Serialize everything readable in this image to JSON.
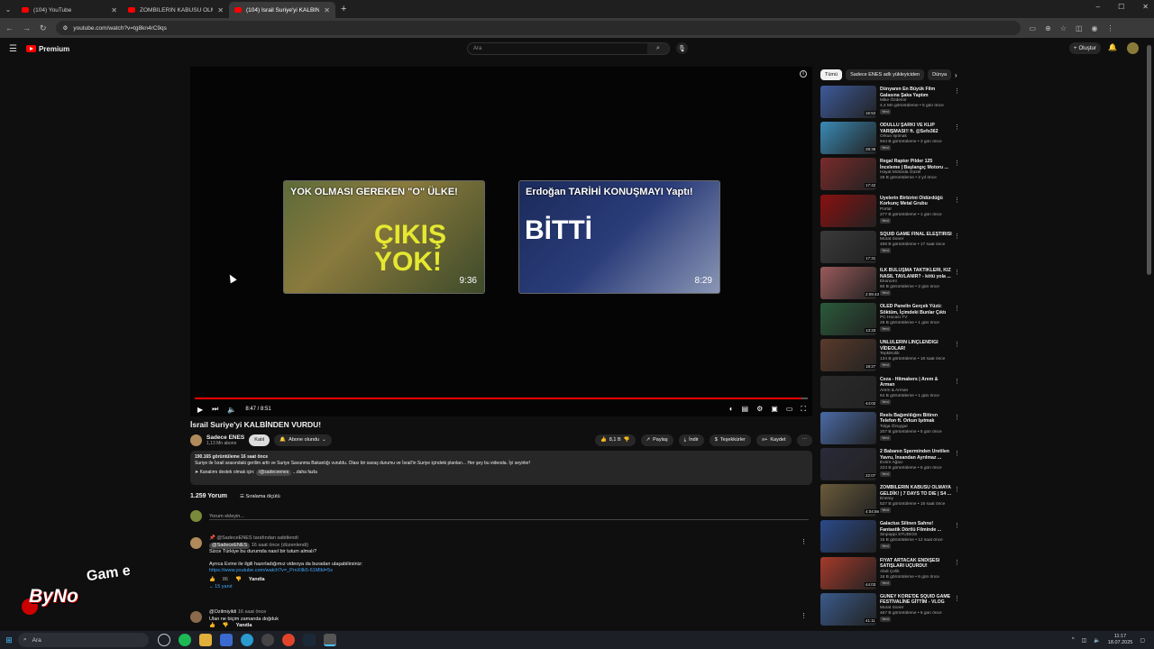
{
  "browser": {
    "tabs": [
      {
        "title": "(104) YouTube",
        "active": false
      },
      {
        "title": "ZOMBİLERİN KABUSU OLMAYA",
        "active": false
      },
      {
        "title": "(104) İsrail Suriye'yi KALBİNDEN",
        "active": true
      }
    ],
    "url": "youtube.com/watch?v=tg8kn4rC9qs"
  },
  "yt": {
    "logo": "Premium",
    "search_placeholder": "Ara",
    "create_label": "Oluştur"
  },
  "player": {
    "endcards": [
      {
        "title": "YOK OLMASI GEREKEN \"O\" ÜLKE!",
        "duration": "9:36"
      },
      {
        "title": "Erdoğan TARİHİ KONUŞMAYI Yaptı!",
        "duration": "8:29"
      }
    ],
    "time": "8:47 / 8:51",
    "progress": 0.99
  },
  "video": {
    "title": "İsrail Suriye'yi KALBİNDEN VURDU!",
    "channel": "Sadece ENES",
    "subs": "1,13 Mn abone",
    "join": "Katıl",
    "subscribed": "Abone olundu",
    "likes": "8,1 B",
    "share": "Paylaş",
    "download": "İndir",
    "thanks": "Teşekkürler",
    "save": "Kaydet",
    "desc_meta": "190.165 görüntüleme  16 saat önce",
    "desc_text": "Suriye ile İsrail arasındaki gerilim arttı ve Suriye Savunma Bakanlığı vuruldu. Olası bir savaş durumu ve İsrail'in Suriye içindeki planları... Her şey bu videoda. İyi seyirler!",
    "desc_support": "➤ Kanalımı destek olmak için:",
    "desc_handle": "/@sadeceenes",
    "desc_more": "...daha fazla"
  },
  "comments": {
    "count": "1.259 Yorum",
    "sort": "Sıralama ölçütü",
    "add_placeholder": "Yorum ekleyin...",
    "items": [
      {
        "pinned": "@SadeceENES tarafından sabitlendi",
        "author": "@SadeceENES",
        "time": "16 saat önce (düzenlendi)",
        "text1": "Sizce Türkiye bu durumda nasıl bir tutum almalı?",
        "text2": "Ayrıca Evine ile ilgili hazırladığımız videoya da buradan ulaşabilirsiniz:",
        "link": "https://www.youtube.com/watch?v=_PrnXIlk5-61Mlbl=5s",
        "likes": "86",
        "reply": "Yanıtla",
        "replies": "15 yanıt"
      },
      {
        "author": "@Ozilmiyildi",
        "time": "16 saat önce",
        "text1": "Ulan ne biçim zamanda doğduk",
        "likes": "",
        "reply": "Yanıtla"
      }
    ]
  },
  "sidebar": {
    "chips": [
      "Tümü",
      "Sadece ENES adlı yükleyiciden",
      "Dünya"
    ],
    "videos": [
      {
        "title": "Dünyanın En Büyük Film Galasına Şaka Yaptım",
        "channel": "Mike Özdemir",
        "meta": "4,4 Mn görüntüleme • 5 gün önce",
        "badge": "Yeni",
        "dur": "16:52",
        "color": "#3d5a9a"
      },
      {
        "title": "ÖDÜLLÜ ŞARKI VE KLİP YARIŞMASI!! ft. @Sefo362",
        "channel": "Orkun Işıtmak",
        "meta": "944 B görüntüleme • 3 gün önce",
        "badge": "Yeni",
        "dur": "28:36",
        "color": "#3a8ab5"
      },
      {
        "title": "Regal Raptor Pilder 125 İnceleme | Başlangıç Motoru ...",
        "channel": "Hayat Motorda Güzel",
        "meta": "28 B görüntüleme • 2 yıl önce",
        "badge": "",
        "dur": "17:42",
        "color": "#7a2a2a"
      },
      {
        "title": "Üyelerin Birbirini Öldürdüğü Korkunç Metal Grubu",
        "channel": "Portal",
        "meta": "277 B görüntüleme • 1 gün önce",
        "badge": "Yeni",
        "dur": "",
        "color": "#8a1010"
      },
      {
        "title": "SQUID GAME FİNAL ELEŞTİRİSİ",
        "channel": "Murat Soner",
        "meta": "406 B görüntüleme • 17 saat önce",
        "badge": "Yeni",
        "dur": "17:31",
        "color": "#3a3a3a"
      },
      {
        "title": "İLK BULUŞMA TAKTİKLERİ, KIZ NASIL TAVLANIR? - kötü yola ...",
        "channel": "Ekonomi",
        "meta": "60 B görüntüleme • 2 gün önce",
        "badge": "Yeni",
        "dur": "2:09:43",
        "color": "#9a5a5a"
      },
      {
        "title": "OLED Panelin Gerçek Yüzü: Söktüm, İçimdeki Bunlar Çıktı",
        "channel": "PC Hocası TV",
        "meta": "26 B görüntüleme • 1 gün önce",
        "badge": "Yeni",
        "dur": "13:33",
        "color": "#2a5a3a"
      },
      {
        "title": "ÜNLÜLERİN LİNÇLENDİĞİ VİDEOLAR!",
        "channel": "TepkiKolik",
        "meta": "134 B görüntüleme • 16 saat önce",
        "badge": "Yeni",
        "dur": "18:27",
        "color": "#5a3a2a"
      },
      {
        "title": "Ceza - Hitmakers | Arem & Arman",
        "channel": "Arem & Arman",
        "meta": "64 B görüntüleme • 1 gün önce",
        "badge": "Yeni",
        "dur": "44:02",
        "color": "#2a2a2a"
      },
      {
        "title": "Reels Bağımlılığını Bitiren Telefon ft. Orkun Işıtmak",
        "channel": "Tolga Özuygur",
        "meta": "207 B görüntüleme • 5 gün önce",
        "badge": "Yeni",
        "dur": "",
        "color": "#4a6aa5"
      },
      {
        "title": "2 Babanın Sperminden Üretilen Yavru, İnsandan Ayrılmaz ...",
        "channel": "Evrim Ağacı",
        "meta": "223 B görüntüleme • 5 gün önce",
        "badge": "Yeni",
        "dur": "22:07",
        "color": "#2a2a3a"
      },
      {
        "title": "ZOMBİLERİN KABUSU OLMAYA GELDİK! | 7 DAYS TO DIE | S4 ...",
        "channel": "Enemy",
        "meta": "527 B görüntüleme • 15 saat önce",
        "badge": "Yeni",
        "dur": "4:04:56",
        "color": "#6a5a3a"
      },
      {
        "title": "Galactus Silinen Sahne! Fantastik Dörtlü Filminde ...",
        "channel": "Sinpoppi STUDIOS",
        "meta": "15 B görüntüleme • 12 saat önce",
        "badge": "Yeni",
        "dur": "",
        "color": "#2a4a8a"
      },
      {
        "title": "FİYAT ARTACAK ENDİŞESİ SATIŞLARI UÇURDU! #rakipkoşte",
        "channel": "Abdi Çelik",
        "meta": "16 B görüntüleme • 6 gün önce",
        "badge": "Yeni",
        "dur": "44:03",
        "color": "#a53a2a"
      },
      {
        "title": "GÜNEY KORE'DE SQUID GAME FESTİVALİNE GİTTİM - VLOG",
        "channel": "Murat Soner",
        "meta": "467 B görüntüleme • 6 gün önce",
        "badge": "Yeni",
        "dur": "41:11",
        "color": "#3a5a8a"
      }
    ]
  },
  "taskbar": {
    "search": "Ara",
    "time": "11:17",
    "date": "18.07.2025"
  },
  "watermark": {
    "line1": "Gam e",
    "line2": "ByNo"
  }
}
